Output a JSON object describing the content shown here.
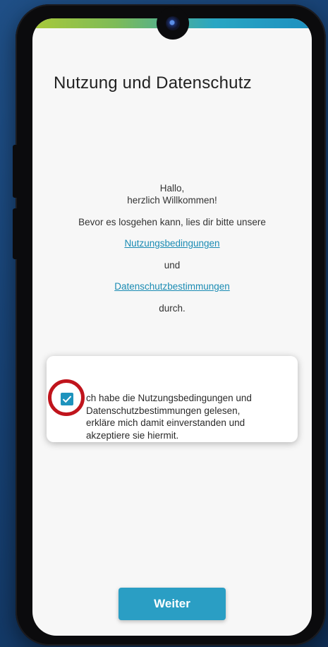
{
  "screen": {
    "title": "Nutzung und Datenschutz",
    "greeting_line1": "Hallo,",
    "greeting_line2": "herzlich Willkommen!",
    "instruction": "Bevor es losgehen kann, lies dir bitte unsere",
    "terms_link": "Nutzungsbedingungen",
    "and": "und",
    "privacy_link": "Datenschutzbestimmungen",
    "durch": "durch."
  },
  "consent": {
    "checked": true,
    "line1": "ch habe die Nutzungsbedingungen und",
    "line2": "Datenschutzbestimmungen gelesen,",
    "line3": "erkläre mich damit einverstanden und",
    "line4": "akzeptiere sie hiermit."
  },
  "button": {
    "label": "Weiter"
  },
  "colors": {
    "accent": "#2a9ec4",
    "link": "#1a8bb3",
    "highlight": "#c0141c",
    "background": "#1f4f86"
  },
  "icons": {
    "checkbox": "check-icon",
    "camera": "camera-icon"
  }
}
